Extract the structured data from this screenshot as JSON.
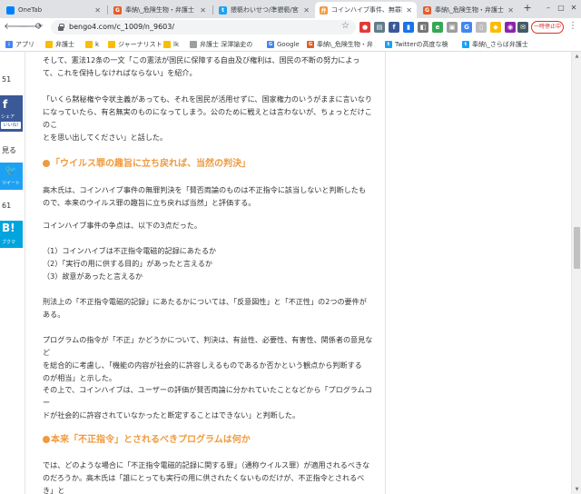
{
  "tabs": [
    {
      "title": "OneTab",
      "favicon": "onetab-icon",
      "color": "#0080ff"
    },
    {
      "title": "奉納\\_危険生物・弁護士",
      "favicon": "bengo4-icon",
      "color": "#e35d2b"
    },
    {
      "title": "猥褻わいせつ/準猥褻/宮",
      "favicon": "twitter-icon",
      "color": "#1da1f2"
    },
    {
      "title": "コインハイブ事件、無罪判",
      "favicon": "bengo4-icon",
      "color": "#f09a3e"
    },
    {
      "title": "奉納\\_危険生物・弁護士",
      "favicon": "bengo4-icon",
      "color": "#e35d2b"
    }
  ],
  "toolbar": {
    "url": "bengo4.com/c_1009/n_9603/",
    "pause_label": "一時停止中"
  },
  "bookmarks": [
    {
      "label": "アプリ",
      "icon": "apps-icon",
      "color": "#4285f4"
    },
    {
      "label": "弁護士",
      "icon": "folder-icon",
      "color": "#fbbc04"
    },
    {
      "label": "k",
      "icon": "folder-icon",
      "color": "#fbbc04"
    },
    {
      "label": "ジャーナリスト",
      "icon": "folder-icon",
      "color": "#fbbc04"
    },
    {
      "label": "lk",
      "icon": "folder-icon",
      "color": "#fbbc04"
    },
    {
      "label": "弁護士 深澤諭史の",
      "icon": "page-icon",
      "color": "#9e9e9e"
    },
    {
      "label": "Google",
      "icon": "google-icon",
      "color": "#4285f4"
    },
    {
      "label": "奉納\\_危険生物・弁",
      "icon": "bengo4-icon",
      "color": "#e35d2b"
    },
    {
      "label": "Twitterの高度な検",
      "icon": "twitter-icon",
      "color": "#1da1f2"
    },
    {
      "label": "奉納\\_さらば弁護士",
      "icon": "twitter-icon",
      "color": "#1da1f2"
    }
  ],
  "sidebar": {
    "count_top": "51",
    "fb_label": "シェア",
    "fb_like": "いいね!",
    "view_label": "見る",
    "tw_label": "ツイート",
    "count_mid": "61",
    "hb_label": "ブクマ"
  },
  "article": {
    "p1": "そして、憲法12条の一文「この憲法が国民に保障する自由及び権利は、国民の不断の努力によっ\nて、これを保持しなければならない」を紹介。",
    "p2": "「いくら黙秘権や令状主義があっても、それを国民が活用せずに、国家権力のいうがままに言いなり\nになっていたら、有名無実のものになってしまう。公のために戦えとは言わないが、ちょっとだけこのこ\nとを思い出してください」と話した。",
    "h1": "「ウイルス罪の趣旨に立ち戻れば、当然の判決」",
    "p3": "高木氏は、コインハイブ事件の無罪判決を「賛否両論のものは不正指令に該当しないと判断したも\nので、本来のウイルス罪の趣旨に立ち戻れば当然」と評価する。",
    "p4": "コインハイブ事件の争点は、以下の3点だった。",
    "p5": "（1）コインハイブは不正指令電磁的記録にあたるか\n（2）「実行の用に供する目的」があったと言えるか\n（3）故意があったと言えるか",
    "p6": "刑法上の「不正指令電磁的記録」にあたるかについては、「反意図性」と「不正性」の2つの要件が\nある。",
    "p7": "プログラムの指令が「不正」かどうかについて、判決は、有益性、必要性、有害性、関係者の意見など\nを総合的に考慮し、「機能の内容が社会的に許容しえるものであるか否かという観点から判断する\nのが相当」と示した。",
    "p8": "その上で、コインハイブは、ユーザーの評価が賛否両論に分かれていたことなどから「プログラムコー\nドが社会的に許容されていなかったと断定することはできない」と判断した。",
    "h2": "本来「不正指令」とされるべきプログラムは何か",
    "p9": "では、どのような場合に「不正指令電磁的記録に関する罪」（通称ウイルス罪）が適用されるべきな\nのだろうか。高木氏は「誰にとっても実行の用に供されたくないものだけが、不正指令とされるべき」と\n話す。"
  },
  "accent_color": "#f09a3e"
}
